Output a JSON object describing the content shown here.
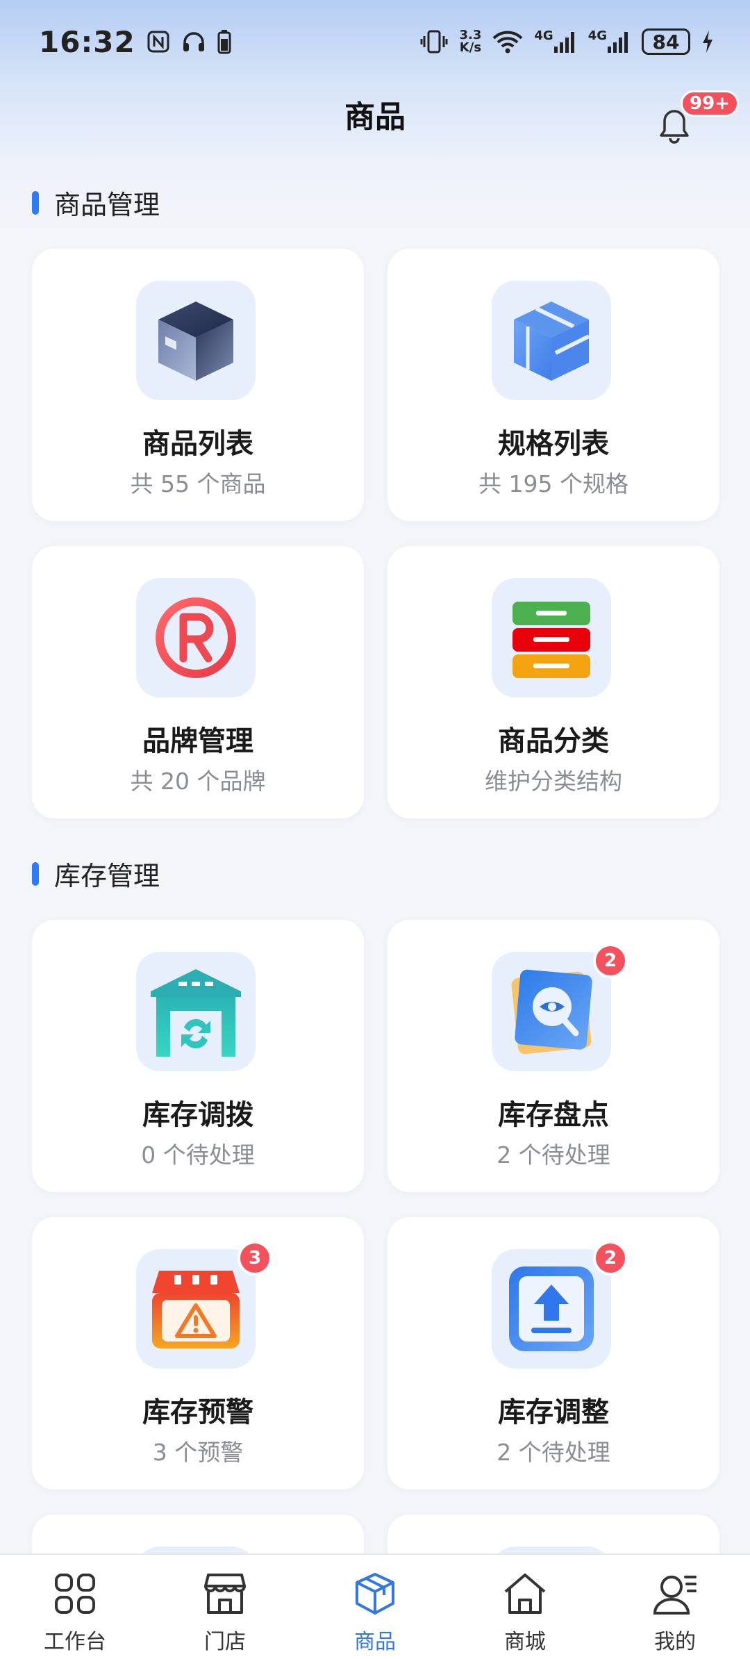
{
  "status_bar": {
    "time": "16:32",
    "net_speed_top": "3.3",
    "net_speed_bottom": "K/s",
    "sim1": "4G",
    "sim2": "4G",
    "battery": "84",
    "icons": [
      "nfc-icon",
      "headphones-icon",
      "battery-small-icon",
      "vibrate-icon",
      "wifi-icon",
      "signal-icon",
      "charging-icon"
    ]
  },
  "header": {
    "title": "商品",
    "notification_badge": "99+"
  },
  "sections": {
    "product": {
      "title": "商品管理"
    },
    "inventory": {
      "title": "库存管理"
    }
  },
  "cards": [
    {
      "title": "商品列表",
      "subtitle": "共 55 个商品",
      "icon": "box-icon",
      "badge": ""
    },
    {
      "title": "规格列表",
      "subtitle": "共 195 个规格",
      "icon": "spec-box-icon",
      "badge": ""
    },
    {
      "title": "品牌管理",
      "subtitle": "共 20 个品牌",
      "icon": "registered-icon",
      "badge": ""
    },
    {
      "title": "商品分类",
      "subtitle": "维护分类结构",
      "icon": "category-icon",
      "badge": ""
    },
    {
      "title": "库存调拨",
      "subtitle": "0 个待处理",
      "icon": "warehouse-transfer-icon",
      "badge": ""
    },
    {
      "title": "库存盘点",
      "subtitle": "2 个待处理",
      "icon": "stock-check-icon",
      "badge": "2"
    },
    {
      "title": "库存预警",
      "subtitle": "3 个预警",
      "icon": "stock-warning-icon",
      "badge": "3"
    },
    {
      "title": "库存调整",
      "subtitle": "2 个待处理",
      "icon": "stock-adjust-icon",
      "badge": "2"
    }
  ],
  "bottom_nav": [
    {
      "label": "工作台",
      "icon": "grid-icon",
      "active": false
    },
    {
      "label": "门店",
      "icon": "store-icon",
      "active": false
    },
    {
      "label": "商品",
      "icon": "product-box-icon",
      "active": true
    },
    {
      "label": "商城",
      "icon": "home-icon",
      "active": false
    },
    {
      "label": "我的",
      "icon": "profile-icon",
      "active": false
    }
  ],
  "colors": {
    "accent": "#2f7bf5",
    "badge": "#f4515f",
    "active_nav": "#3278e0"
  }
}
